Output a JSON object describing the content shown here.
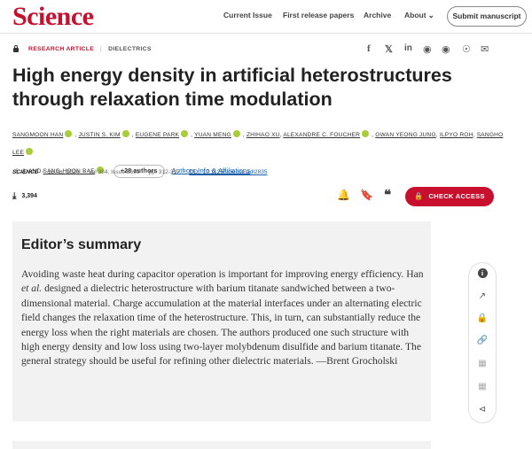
{
  "header": {
    "logo": "Science",
    "nav": {
      "current_issue": "Current Issue",
      "first_release": "First release papers",
      "archive": "Archive",
      "about": "About"
    },
    "submit": "Submit manuscript"
  },
  "article": {
    "type": "RESEARCH ARTICLE",
    "section": "DIELECTRICS",
    "share_icons": [
      "facebook-icon",
      "x-icon",
      "linkedin-icon",
      "reddit-icon",
      "wechat-icon",
      "weibo-icon",
      "email-icon"
    ],
    "title": "High energy density in artificial heterostructures through relaxation time modulation",
    "authors": [
      "SANGMOON HAN",
      "JUSTIN S. KIM",
      "EUGENE PARK",
      "YUAN MENG",
      "ZHIHAO XU",
      "ALEXANDRE C. FOUCHER",
      "GWAN YEONG JUNG",
      "ILPYO ROH",
      "SANGHO LEE"
    ],
    "authors_ellipsis": "[...]",
    "authors_and": "AND",
    "last_author": "SANG-HOON BAE",
    "more_authors": "+28 authors",
    "affiliations_link": "Authors Info & Affiliations",
    "citation": {
      "journal": "SCIENCE",
      "date": "18 Apr 2024",
      "volume": "Vol 384, Issue 6693",
      "pages": "pp. 312-317",
      "doi": "DOI: 10.1126/science.adl2835"
    },
    "downloads": "3,394",
    "check_access": "CHECK ACCESS"
  },
  "summary": {
    "heading": "Editor’s summary",
    "text_before": "Avoiding waste heat during capacitor operation is important for improving energy efficiency. Han ",
    "text_italic": "et al.",
    "text_after": " designed a dielectric heterostructure with barium titanate sandwiched between a two-dimensional material. Charge accumulation at the material interfaces under an alternating electric field changes the relaxation time of the heterostructure. This, in turn, can substantially reduce the energy loss when the right materials are chosen. The authors produced one such structure with high energy density and low loss using two-layer molybdenum disulfide and barium titanate. The general strategy should be useful for refining other dielectric materials. —Brent Grocholski"
  },
  "colors": {
    "brand_red": "#c8102e",
    "link_blue": "#1a5ea8",
    "orcid_green": "#a6ce39",
    "summary_bg": "#f2f2f2"
  }
}
